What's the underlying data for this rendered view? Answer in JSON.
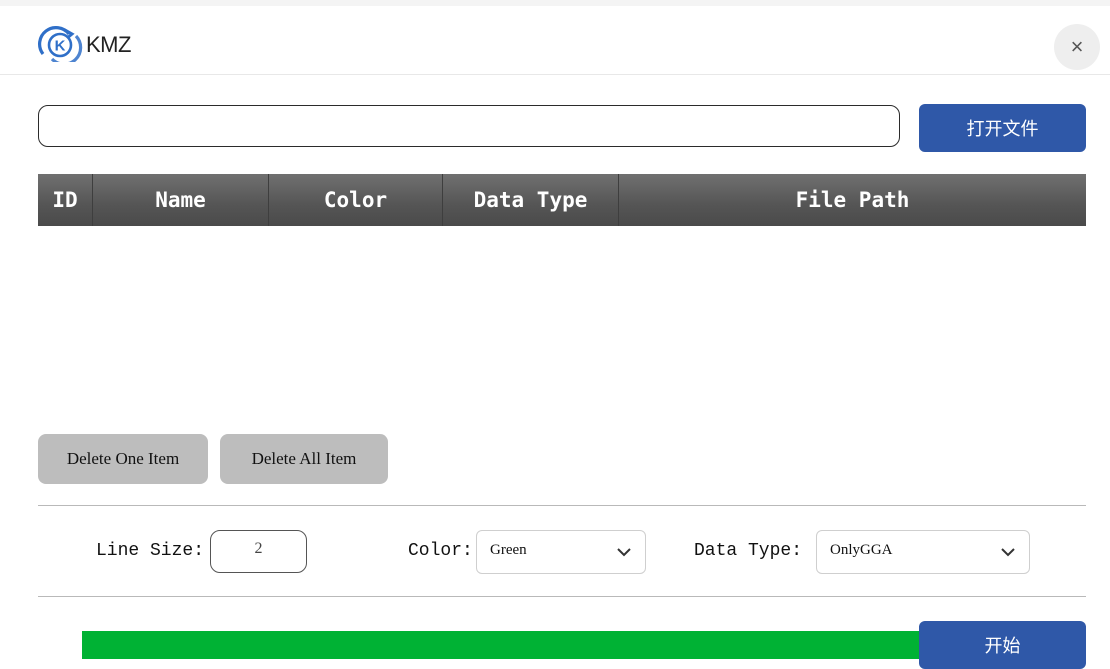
{
  "window": {
    "title": "KMZ",
    "logo_letter": "K",
    "close_glyph": "×"
  },
  "file": {
    "path_value": "",
    "open_label": "打开文件"
  },
  "table": {
    "columns": [
      "ID",
      "Name",
      "Color",
      "Data Type",
      "File Path"
    ],
    "rows": []
  },
  "actions": {
    "delete_one": "Delete One Item",
    "delete_all": "Delete All Item"
  },
  "settings": {
    "line_size_label": "Line Size:",
    "line_size_value": "2",
    "color_label": "Color:",
    "color_value": "Green",
    "data_type_label": "Data Type:",
    "data_type_value": "OnlyGGA"
  },
  "progress": {
    "fraction": 1.0,
    "color": "#00b234"
  },
  "start_label": "开始",
  "colors": {
    "accent": "#2f58a8",
    "header_bg": "#555555",
    "logo": "#2f6fc8"
  },
  "icons": {
    "logo": "k-circle-arrows-icon",
    "close": "close-icon",
    "dropdown": "chevron-down-icon"
  }
}
